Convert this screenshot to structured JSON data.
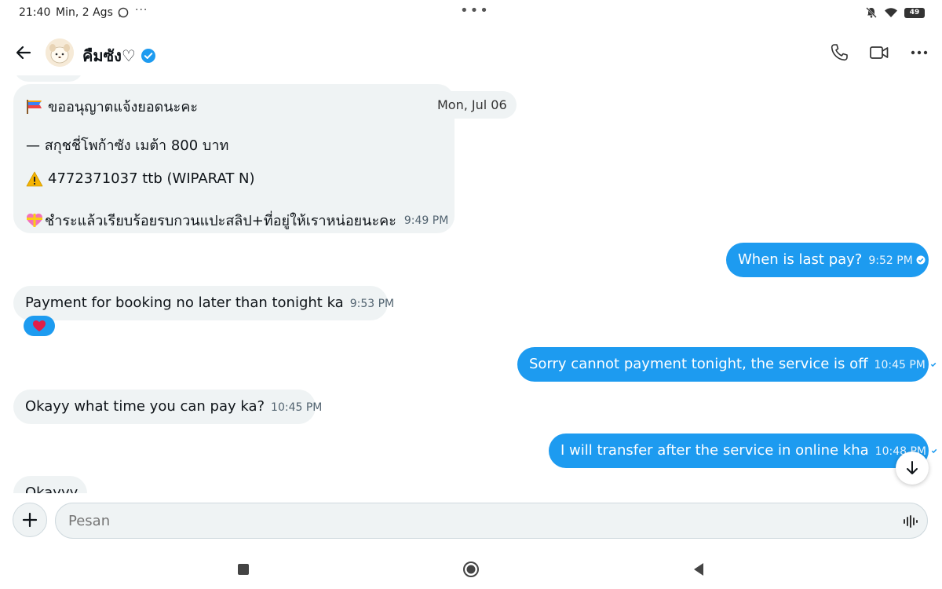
{
  "status_bar": {
    "time": "21:40",
    "date": "Min, 2 Ags",
    "dots_left": "···",
    "dots_center": "•••",
    "battery": "49"
  },
  "header": {
    "contact_name": "คืมซัง♡"
  },
  "chat": {
    "date_separator": "Mon, Jul 06",
    "messages": [
      {
        "direction": "in",
        "lines": [
          "ขออนุญาตแจ้งยอดนะคะ",
          "— สกุชชี่โพก้าซัง เมต้า 800 บาท",
          "4772371037 ttb (WIPARAT N)",
          "ชำระแล้วเรียบร้อยรบกวนแปะสลิป+ที่อยู่ให้เราหน่อยนะคะ"
        ],
        "time": "9:49 PM"
      },
      {
        "direction": "out",
        "text": "When is last pay?",
        "time": "9:52 PM"
      },
      {
        "direction": "in",
        "text": "Payment for booking no later than tonight ka",
        "time": "9:53 PM",
        "reaction": "❤️"
      },
      {
        "direction": "out",
        "text": "Sorry cannot payment tonight, the service is off",
        "time": "10:45 PM"
      },
      {
        "direction": "in",
        "text": "Okayy what time you can pay ka?",
        "time": "10:45 PM"
      },
      {
        "direction": "out",
        "text": "I will transfer after the service in online kha",
        "time": "10:48 PM"
      },
      {
        "direction": "in",
        "text": "Okayyy",
        "time": ""
      }
    ]
  },
  "composer": {
    "placeholder": "Pesan"
  },
  "colors": {
    "accent": "#1d9bf0",
    "incoming_bubble": "#eff3f4",
    "verified": "#1d9bf0"
  },
  "icons": [
    "back-arrow-icon",
    "verified-badge-icon",
    "phone-icon",
    "video-icon",
    "more-icon",
    "plus-icon",
    "voice-wave-icon",
    "scroll-down-icon"
  ]
}
